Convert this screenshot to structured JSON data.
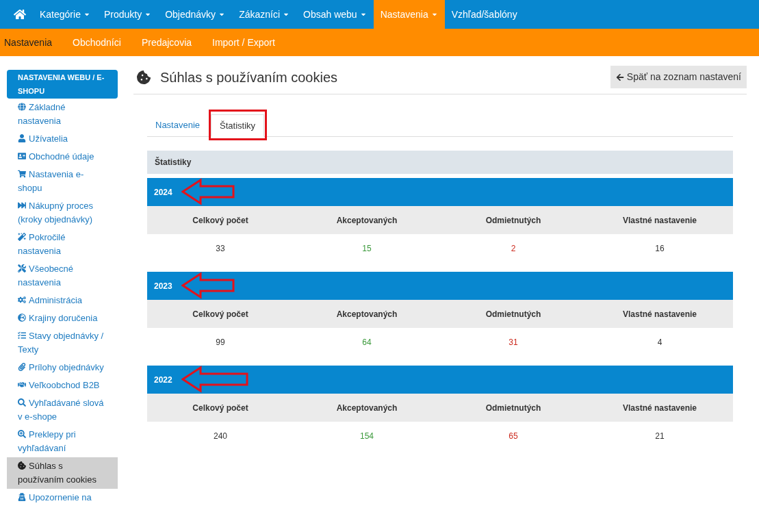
{
  "top_nav": [
    {
      "label": "Kategórie",
      "dropdown": true,
      "selected": false
    },
    {
      "label": "Produkty",
      "dropdown": true,
      "selected": false
    },
    {
      "label": "Objednávky",
      "dropdown": true,
      "selected": false
    },
    {
      "label": "Zákazníci",
      "dropdown": true,
      "selected": false
    },
    {
      "label": "Obsah webu",
      "dropdown": true,
      "selected": false
    },
    {
      "label": "Nastavenia",
      "dropdown": true,
      "selected": true
    },
    {
      "label": "Vzhľad/šablóny",
      "dropdown": false,
      "selected": false
    }
  ],
  "sub_nav": [
    {
      "label": "Nastavenia",
      "selected": true
    },
    {
      "label": "Obchodníci",
      "selected": false
    },
    {
      "label": "Predajcovia",
      "selected": false
    },
    {
      "label": "Import / Export",
      "selected": false
    }
  ],
  "sidebar": {
    "heading": "NASTAVENIA WEBU / E-SHOPU",
    "items": [
      {
        "label": "Základné nastavenia",
        "selected": false
      },
      {
        "label": "Užívatelia",
        "selected": false
      },
      {
        "label": "Obchodné údaje",
        "selected": false
      },
      {
        "label": "Nastavenia e-shopu",
        "selected": false
      },
      {
        "label": "Nákupný proces (kroky objednávky)",
        "selected": false
      },
      {
        "label": "Pokročilé nastavenia",
        "selected": false
      },
      {
        "label": "Všeobecné nastavenia",
        "selected": false
      },
      {
        "label": "Administrácia",
        "selected": false
      },
      {
        "label": "Krajiny doručenia",
        "selected": false
      },
      {
        "label": "Stavy objednávky / Texty",
        "selected": false
      },
      {
        "label": "Prílohy objednávky",
        "selected": false
      },
      {
        "label": "Veľkoobchod B2B",
        "selected": false
      },
      {
        "label": "Vyhľadávané slová v e-shope",
        "selected": false
      },
      {
        "label": "Preklepy pri vyhľadávaní",
        "selected": false
      },
      {
        "label": "Súhlas s používaním cookies",
        "selected": true
      },
      {
        "label": "Upozornenie na",
        "selected": false
      }
    ]
  },
  "page": {
    "title": "Súhlas s používaním cookies",
    "back_button": "Späť na zoznam nastavení"
  },
  "tabs": [
    {
      "label": "Nastavenie",
      "selected": false,
      "highlighted": false
    },
    {
      "label": "Štatistiky",
      "selected": true,
      "highlighted": true
    }
  ],
  "panel_title": "Štatistiky",
  "years": [
    {
      "year": "2024",
      "arrow": true,
      "columns": [
        "Celkový počet",
        "Akceptovaných",
        "Odmietnutých",
        "Vlastné nastavenie"
      ],
      "values": [
        {
          "text": "33",
          "color": "#333333"
        },
        {
          "text": "15",
          "color": "#3c9a3c"
        },
        {
          "text": "2",
          "color": "#cc2a1e"
        },
        {
          "text": "16",
          "color": "#333333"
        }
      ]
    },
    {
      "year": "2023",
      "arrow": true,
      "columns": [
        "Celkový počet",
        "Akceptovaných",
        "Odmietnutých",
        "Vlastné nastavenie"
      ],
      "values": [
        {
          "text": "99",
          "color": "#333333"
        },
        {
          "text": "64",
          "color": "#3c9a3c"
        },
        {
          "text": "31",
          "color": "#cc2a1e"
        },
        {
          "text": "4",
          "color": "#333333"
        }
      ]
    },
    {
      "year": "2022",
      "arrow": true,
      "columns": [
        "Celkový počet",
        "Akceptovaných",
        "Odmietnutých",
        "Vlastné nastavenie"
      ],
      "values": [
        {
          "text": "240",
          "color": "#333333"
        },
        {
          "text": "154",
          "color": "#3c9a3c"
        },
        {
          "text": "65",
          "color": "#cc2a1e"
        },
        {
          "text": "21",
          "color": "#333333"
        }
      ]
    }
  ]
}
